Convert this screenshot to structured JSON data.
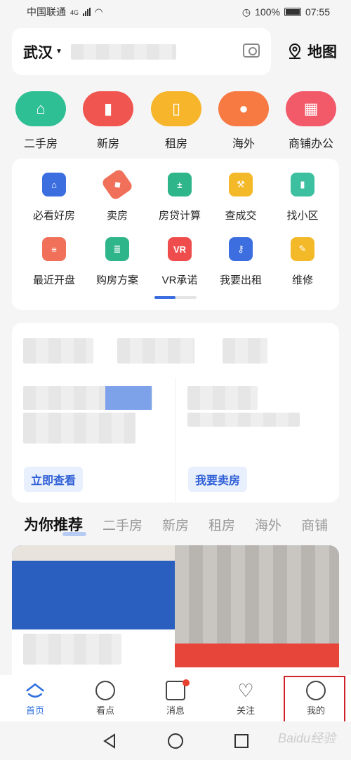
{
  "status_bar": {
    "carrier": "中国联通",
    "network": "4G",
    "battery": "100%",
    "time": "07:55"
  },
  "header": {
    "city": "武汉",
    "map_label": "地图"
  },
  "categories": [
    {
      "label": "二手房",
      "color": "#2fbf94",
      "icon": "house-icon"
    },
    {
      "label": "新房",
      "color": "#f0554f",
      "icon": "building-icon"
    },
    {
      "label": "租房",
      "color": "#f6b52b",
      "icon": "door-icon"
    },
    {
      "label": "海外",
      "color": "#f77a43",
      "icon": "globe-icon"
    },
    {
      "label": "商铺办公",
      "color": "#f25a6a",
      "icon": "shop-icon"
    }
  ],
  "tools": [
    {
      "label": "必看好房",
      "color": "#3d6ee0",
      "icon": "shield-house-icon"
    },
    {
      "label": "卖房",
      "color": "#f0705a",
      "icon": "tag-icon"
    },
    {
      "label": "房贷计算",
      "color": "#2fb58a",
      "icon": "calculator-icon"
    },
    {
      "label": "查成交",
      "color": "#f4b928",
      "icon": "gavel-icon"
    },
    {
      "label": "找小区",
      "color": "#3cc0a0",
      "icon": "building-icon"
    },
    {
      "label": "最近开盘",
      "color": "#f0705a",
      "icon": "chart-icon"
    },
    {
      "label": "购房方案",
      "color": "#2fb58a",
      "icon": "document-icon"
    },
    {
      "label": "VR承诺",
      "color": "#ef4d4d",
      "icon": "vr-icon"
    },
    {
      "label": "我要出租",
      "color": "#3d6ee0",
      "icon": "key-icon"
    },
    {
      "label": "维修",
      "color": "#f4b928",
      "icon": "wrench-icon"
    }
  ],
  "info_card": {
    "left_button": "立即查看",
    "right_button": "我要卖房"
  },
  "recommend_tabs": [
    "为你推荐",
    "二手房",
    "新房",
    "租房",
    "海外",
    "商铺"
  ],
  "bottom_nav": [
    {
      "label": "首页",
      "icon": "home-icon",
      "active": true
    },
    {
      "label": "看点",
      "icon": "discover-icon",
      "active": false
    },
    {
      "label": "消息",
      "icon": "message-icon",
      "active": false
    },
    {
      "label": "关注",
      "icon": "heart-icon",
      "active": false
    },
    {
      "label": "我的",
      "icon": "profile-icon",
      "active": false
    }
  ],
  "watermark": "Baidu经验",
  "accent_color": "#2f6fe0"
}
